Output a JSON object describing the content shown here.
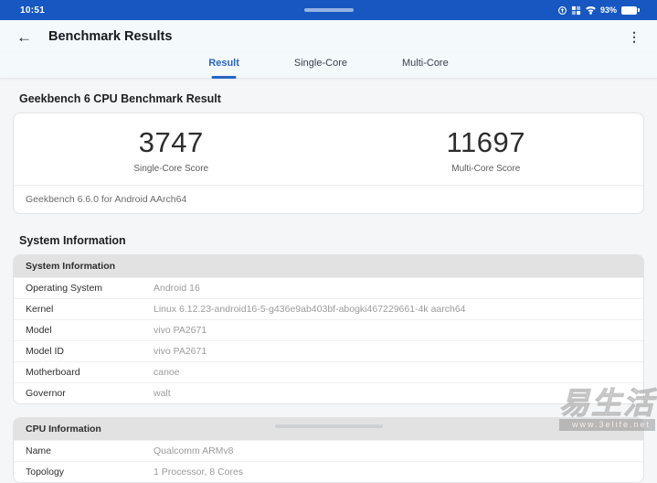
{
  "colors": {
    "statusbar_blue": "#1657c2",
    "accent_blue": "#2a63c4",
    "table_header_gray": "#e2e2e2"
  },
  "status_bar": {
    "time": "10:51",
    "battery_percent": "93%"
  },
  "header": {
    "title": "Benchmark Results"
  },
  "tabs": {
    "items": [
      {
        "label": "Result"
      },
      {
        "label": "Single-Core"
      },
      {
        "label": "Multi-Core"
      }
    ]
  },
  "result": {
    "heading": "Geekbench 6 CPU Benchmark Result",
    "single_core": {
      "value": "3747",
      "label": "Single-Core Score"
    },
    "multi_core": {
      "value": "11697",
      "label": "Multi-Core Score"
    },
    "version": "Geekbench 6.6.0 for Android AArch64"
  },
  "system": {
    "heading": "System Information",
    "table": {
      "title": "System Information",
      "rows": [
        {
          "label": "Operating System",
          "value": "Android 16"
        },
        {
          "label": "Kernel",
          "value": "Linux 6.12.23-android16-5-g436e9ab403bf-abogki467229661-4k aarch64"
        },
        {
          "label": "Model",
          "value": "vivo PA2671"
        },
        {
          "label": "Model ID",
          "value": "vivo PA2671"
        },
        {
          "label": "Motherboard",
          "value": "canoe"
        },
        {
          "label": "Governor",
          "value": "walt"
        }
      ]
    }
  },
  "cpu": {
    "table": {
      "title": "CPU Information",
      "rows": [
        {
          "label": "Name",
          "value": "Qualcomm ARMv8"
        },
        {
          "label": "Topology",
          "value": "1 Processor, 8 Cores"
        }
      ]
    }
  },
  "watermark": {
    "brand": "易生活",
    "url": "www.3elife.net"
  }
}
